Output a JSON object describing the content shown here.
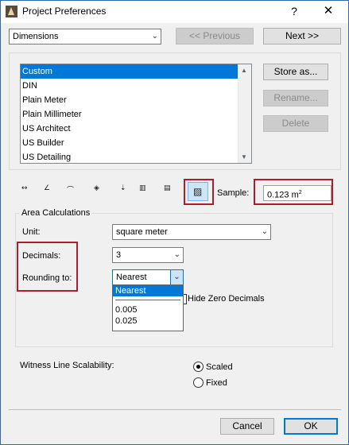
{
  "window": {
    "title": "Project Preferences",
    "help": "?",
    "close": "✕"
  },
  "nav": {
    "page_select": "Dimensions",
    "previous": "<< Previous",
    "next": "Next >>"
  },
  "standards": {
    "items": [
      "Custom",
      "DIN",
      "Plain Meter",
      "Plain Millimeter",
      "US Architect",
      "US Builder",
      "US Detailing"
    ],
    "selected_index": 0,
    "store_as": "Store as...",
    "rename": "Rename...",
    "delete": "Delete"
  },
  "toolbar": {
    "icons": [
      "linear-dimension-icon",
      "angle-dimension-icon",
      "radial-dimension-icon",
      "level-dimension-icon",
      "elevation-dimension-icon",
      "door-window-dimension-icon",
      "sill-height-dimension-icon",
      "area-calculation-icon"
    ],
    "glyphs": [
      "↔",
      "∠",
      "⌒",
      "◈",
      "⇣",
      "▥",
      "▤",
      "▨"
    ],
    "sample_label": "Sample:",
    "sample_value": "0.123 m",
    "sample_sup": "2"
  },
  "area": {
    "group_title": "Area Calculations",
    "unit_label": "Unit:",
    "unit_value": "square meter",
    "decimals_label": "Decimals:",
    "decimals_value": "3",
    "rounding_label": "Rounding to:",
    "rounding_value": "Nearest",
    "rounding_options": [
      "Nearest",
      "0.005",
      "0.025"
    ],
    "hide_zero_label": "Hide Zero Decimals"
  },
  "witness": {
    "label": "Witness Line Scalability:",
    "options": [
      "Scaled",
      "Fixed"
    ],
    "selected": "Scaled"
  },
  "footer": {
    "cancel": "Cancel",
    "ok": "OK"
  },
  "colors": {
    "accent": "#0078d7",
    "highlight": "#b01c2e"
  }
}
